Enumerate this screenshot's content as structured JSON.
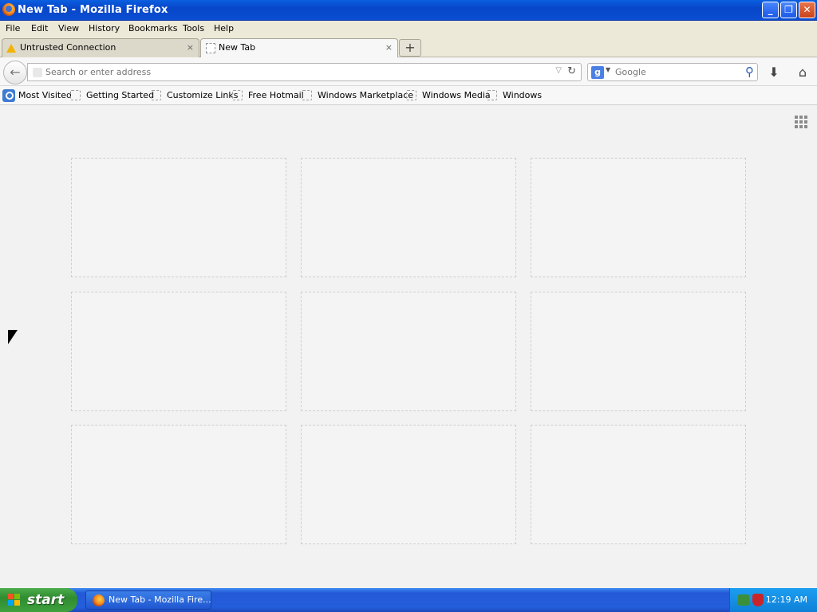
{
  "window": {
    "title": "New Tab - Mozilla Firefox",
    "min": "_",
    "restore": "❐",
    "close": "✕"
  },
  "menu": [
    "File",
    "Edit",
    "View",
    "History",
    "Bookmarks",
    "Tools",
    "Help"
  ],
  "tabs": [
    {
      "label": "Untrusted Connection",
      "close": "×"
    },
    {
      "label": "New Tab",
      "close": "×"
    }
  ],
  "new_tab_button": "+",
  "nav": {
    "back": "←",
    "url_placeholder": "Search or enter address",
    "url_value": "",
    "drop": "▽",
    "reload": "↻",
    "search_engine": "g",
    "search_placeholder": "Google",
    "search_icon": "magnifier-icon",
    "download": "⬇",
    "home": "⌂"
  },
  "bookmarks": [
    "Most Visited",
    "Getting Started",
    "Customize Links",
    "Free Hotmail",
    "Windows Marketplace",
    "Windows Media",
    "Windows"
  ],
  "newtab_tiles_count": 9,
  "taskbar": {
    "start": "start",
    "task": "New Tab - Mozilla Fire...",
    "time": "12:19 AM"
  }
}
